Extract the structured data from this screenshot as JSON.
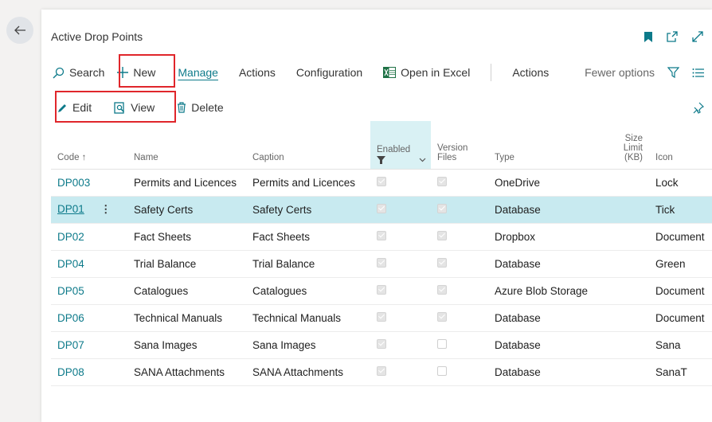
{
  "page": {
    "title": "Active Drop Points"
  },
  "colors": {
    "accent": "#0d7a8a",
    "highlight": "#e0262b",
    "selected_row": "#c8eaf0"
  },
  "header": {
    "icons": [
      "bookmark-icon",
      "open-new-window-icon",
      "expand-icon"
    ]
  },
  "action_bar": {
    "search": "Search",
    "new": "New",
    "manage": "Manage",
    "actions": "Actions",
    "configuration": "Configuration",
    "open_in_excel": "Open in Excel",
    "actions_right": "Actions",
    "fewer_options": "Fewer options"
  },
  "sub_bar": {
    "edit": "Edit",
    "view": "View",
    "delete": "Delete"
  },
  "columns": {
    "code": "Code ↑",
    "name": "Name",
    "caption": "Caption",
    "enabled": "Enabled",
    "version_files_1": "Version",
    "version_files_2": "Files",
    "type": "Type",
    "size_limit_1": "Size",
    "size_limit_2": "Limit",
    "size_limit_3": "(KB)",
    "icon": "Icon"
  },
  "rows": [
    {
      "code": "DP003",
      "name": "Permits and Licences",
      "caption": "Permits and Licences",
      "enabled": true,
      "version_files": true,
      "type": "OneDrive",
      "size_limit": "",
      "icon": "Lock"
    },
    {
      "code": "DP01",
      "name": "Safety Certs",
      "caption": "Safety Certs",
      "enabled": true,
      "version_files": true,
      "type": "Database",
      "size_limit": "",
      "icon": "Tick"
    },
    {
      "code": "DP02",
      "name": "Fact Sheets",
      "caption": "Fact Sheets",
      "enabled": true,
      "version_files": true,
      "type": "Dropbox",
      "size_limit": "",
      "icon": "Document"
    },
    {
      "code": "DP04",
      "name": "Trial Balance",
      "caption": "Trial Balance",
      "enabled": true,
      "version_files": true,
      "type": "Database",
      "size_limit": "",
      "icon": "Green"
    },
    {
      "code": "DP05",
      "name": "Catalogues",
      "caption": "Catalogues",
      "enabled": true,
      "version_files": true,
      "type": "Azure Blob Storage",
      "size_limit": "",
      "icon": "Document"
    },
    {
      "code": "DP06",
      "name": "Technical Manuals",
      "caption": "Technical Manuals",
      "enabled": true,
      "version_files": true,
      "type": "Database",
      "size_limit": "",
      "icon": "Document"
    },
    {
      "code": "DP07",
      "name": "Sana Images",
      "caption": "Sana Images",
      "enabled": true,
      "version_files": false,
      "type": "Database",
      "size_limit": "",
      "icon": "Sana"
    },
    {
      "code": "DP08",
      "name": "SANA Attachments",
      "caption": "SANA Attachments",
      "enabled": true,
      "version_files": false,
      "type": "Database",
      "size_limit": "",
      "icon": "SanaT"
    }
  ]
}
